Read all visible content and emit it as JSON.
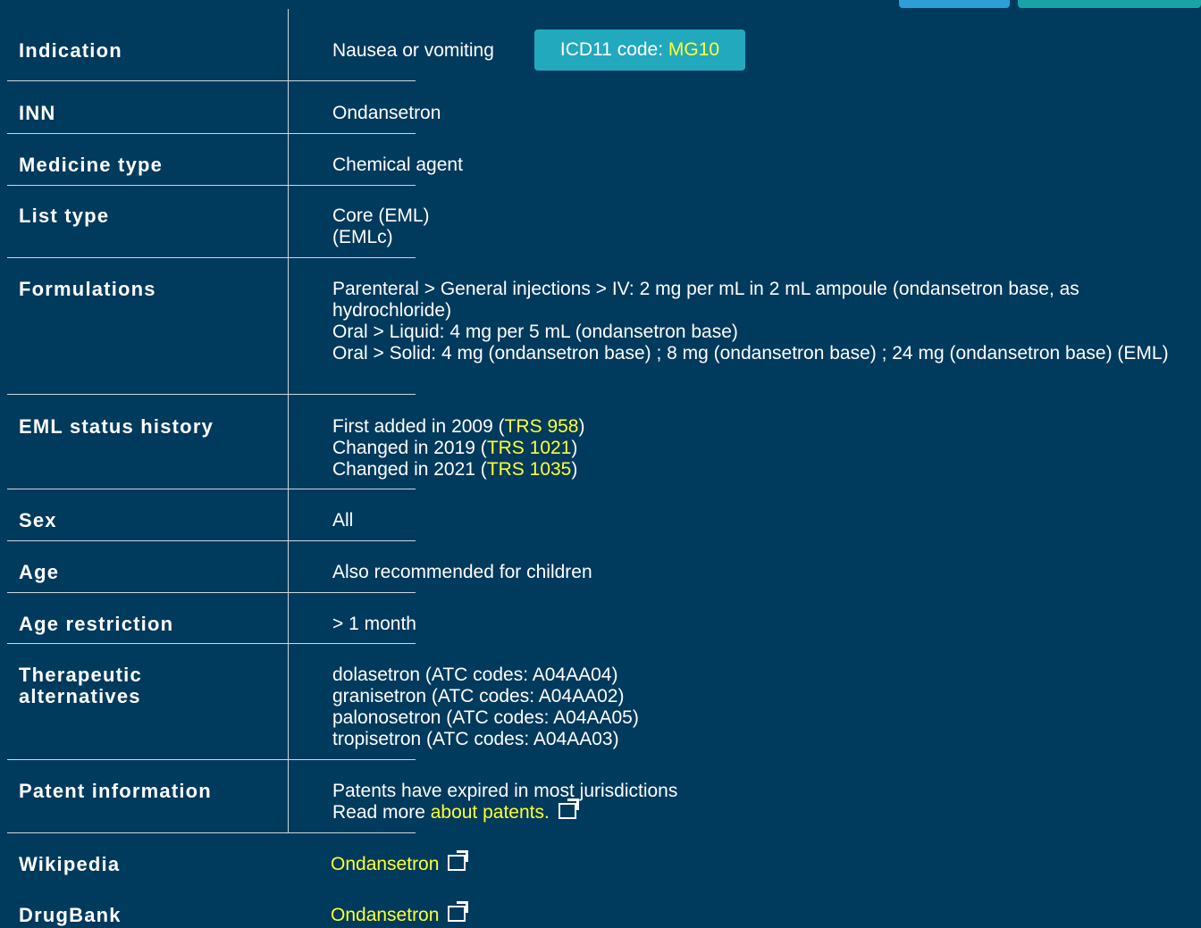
{
  "rows": {
    "indication": {
      "label": "Indication",
      "value": "Nausea or vomiting",
      "icd_prefix": "ICD11 code: ",
      "icd_code": "MG10"
    },
    "inn": {
      "label": "INN",
      "value": "Ondansetron"
    },
    "medicine_type": {
      "label": "Medicine type",
      "value": "Chemical agent"
    },
    "list_type": {
      "label": "List type",
      "lines": [
        "Core (EML)",
        "(EMLc)"
      ]
    },
    "formulations": {
      "label": "Formulations",
      "lines": [
        "Parenteral > General injections > IV: 2 mg per mL in 2 mL ampoule (ondansetron base, as hydrochloride)",
        "Oral > Liquid: 4 mg per 5 mL (ondansetron base)",
        "Oral > Solid: 4 mg (ondansetron base) ; 8 mg (ondansetron base) ; 24 mg (ondansetron base) (EML)"
      ]
    },
    "eml_status": {
      "label": "EML status history",
      "items": [
        {
          "text": "First added in 2009 (",
          "link": "TRS 958",
          "end": ")"
        },
        {
          "text": "Changed in 2019 (",
          "link": "TRS 1021",
          "end": ")"
        },
        {
          "text": "Changed in 2021 (",
          "link": "TRS 1035",
          "end": ")"
        }
      ]
    },
    "sex": {
      "label": "Sex",
      "value": "All"
    },
    "age": {
      "label": "Age",
      "value": "Also recommended for children"
    },
    "age_restriction": {
      "label": "Age restriction",
      "value": "> 1 month"
    },
    "therapeutic_alternatives": {
      "label_line1": "Therapeutic",
      "label_line2": "alternatives",
      "lines": [
        "dolasetron (ATC codes: A04AA04)",
        "granisetron (ATC codes: A04AA02)",
        "palonosetron (ATC codes: A04AA05)",
        "tropisetron (ATC codes: A04AA03)"
      ]
    },
    "patent": {
      "label": "Patent information",
      "line1": "Patents have expired in most jurisdictions",
      "read_more": "Read more ",
      "link": "about patents."
    },
    "wikipedia": {
      "label": "Wikipedia",
      "link": "Ondansetron"
    },
    "drugbank": {
      "label": "DrugBank",
      "link": "Ondansetron"
    }
  }
}
